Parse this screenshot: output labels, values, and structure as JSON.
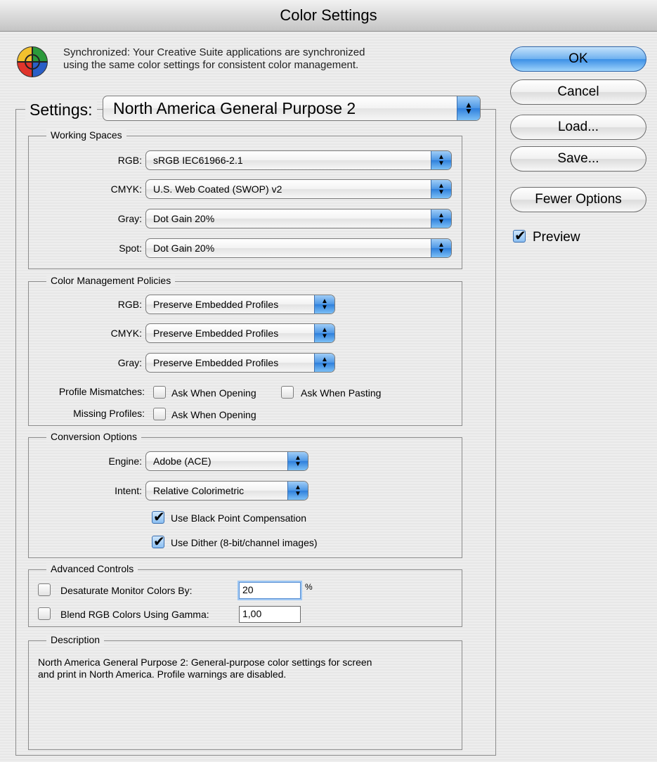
{
  "window": {
    "title": "Color Settings"
  },
  "sync": {
    "line1": "Synchronized: Your Creative Suite applications are synchronized",
    "line2": "using the same color settings for consistent color management."
  },
  "settings": {
    "label": "Settings:",
    "value": "North America General Purpose 2"
  },
  "working_spaces": {
    "title": "Working Spaces",
    "rgb": {
      "label": "RGB:",
      "value": "sRGB IEC61966-2.1"
    },
    "cmyk": {
      "label": "CMYK:",
      "value": "U.S. Web Coated (SWOP) v2"
    },
    "gray": {
      "label": "Gray:",
      "value": "Dot Gain 20%"
    },
    "spot": {
      "label": "Spot:",
      "value": "Dot Gain 20%"
    }
  },
  "policies": {
    "title": "Color Management Policies",
    "rgb": {
      "label": "RGB:",
      "value": "Preserve Embedded Profiles"
    },
    "cmyk": {
      "label": "CMYK:",
      "value": "Preserve Embedded Profiles"
    },
    "gray": {
      "label": "Gray:",
      "value": "Preserve Embedded Profiles"
    },
    "mismatch_label": "Profile Mismatches:",
    "ask_opening": "Ask When Opening",
    "ask_pasting": "Ask When Pasting",
    "missing_label": "Missing Profiles:",
    "missing_ask_opening": "Ask When Opening"
  },
  "conversion": {
    "title": "Conversion Options",
    "engine": {
      "label": "Engine:",
      "value": "Adobe (ACE)"
    },
    "intent": {
      "label": "Intent:",
      "value": "Relative Colorimetric"
    },
    "black_point": "Use Black Point Compensation",
    "dither": "Use Dither (8-bit/channel images)"
  },
  "advanced": {
    "title": "Advanced Controls",
    "desaturate_label": "Desaturate Monitor Colors By:",
    "desaturate_value": "20",
    "percent": "%",
    "blend_label": "Blend RGB Colors Using Gamma:",
    "blend_value": "1,00"
  },
  "description": {
    "title": "Description",
    "line1": "North America General Purpose 2:  General-purpose color settings for screen",
    "line2": "and print in North America. Profile warnings are disabled."
  },
  "buttons": {
    "ok": "OK",
    "cancel": "Cancel",
    "load": "Load...",
    "save": "Save...",
    "fewer": "Fewer Options"
  },
  "preview": {
    "label": "Preview",
    "checked": true
  },
  "colors": {
    "accent": "#4d97e6",
    "background": "#ececec"
  }
}
